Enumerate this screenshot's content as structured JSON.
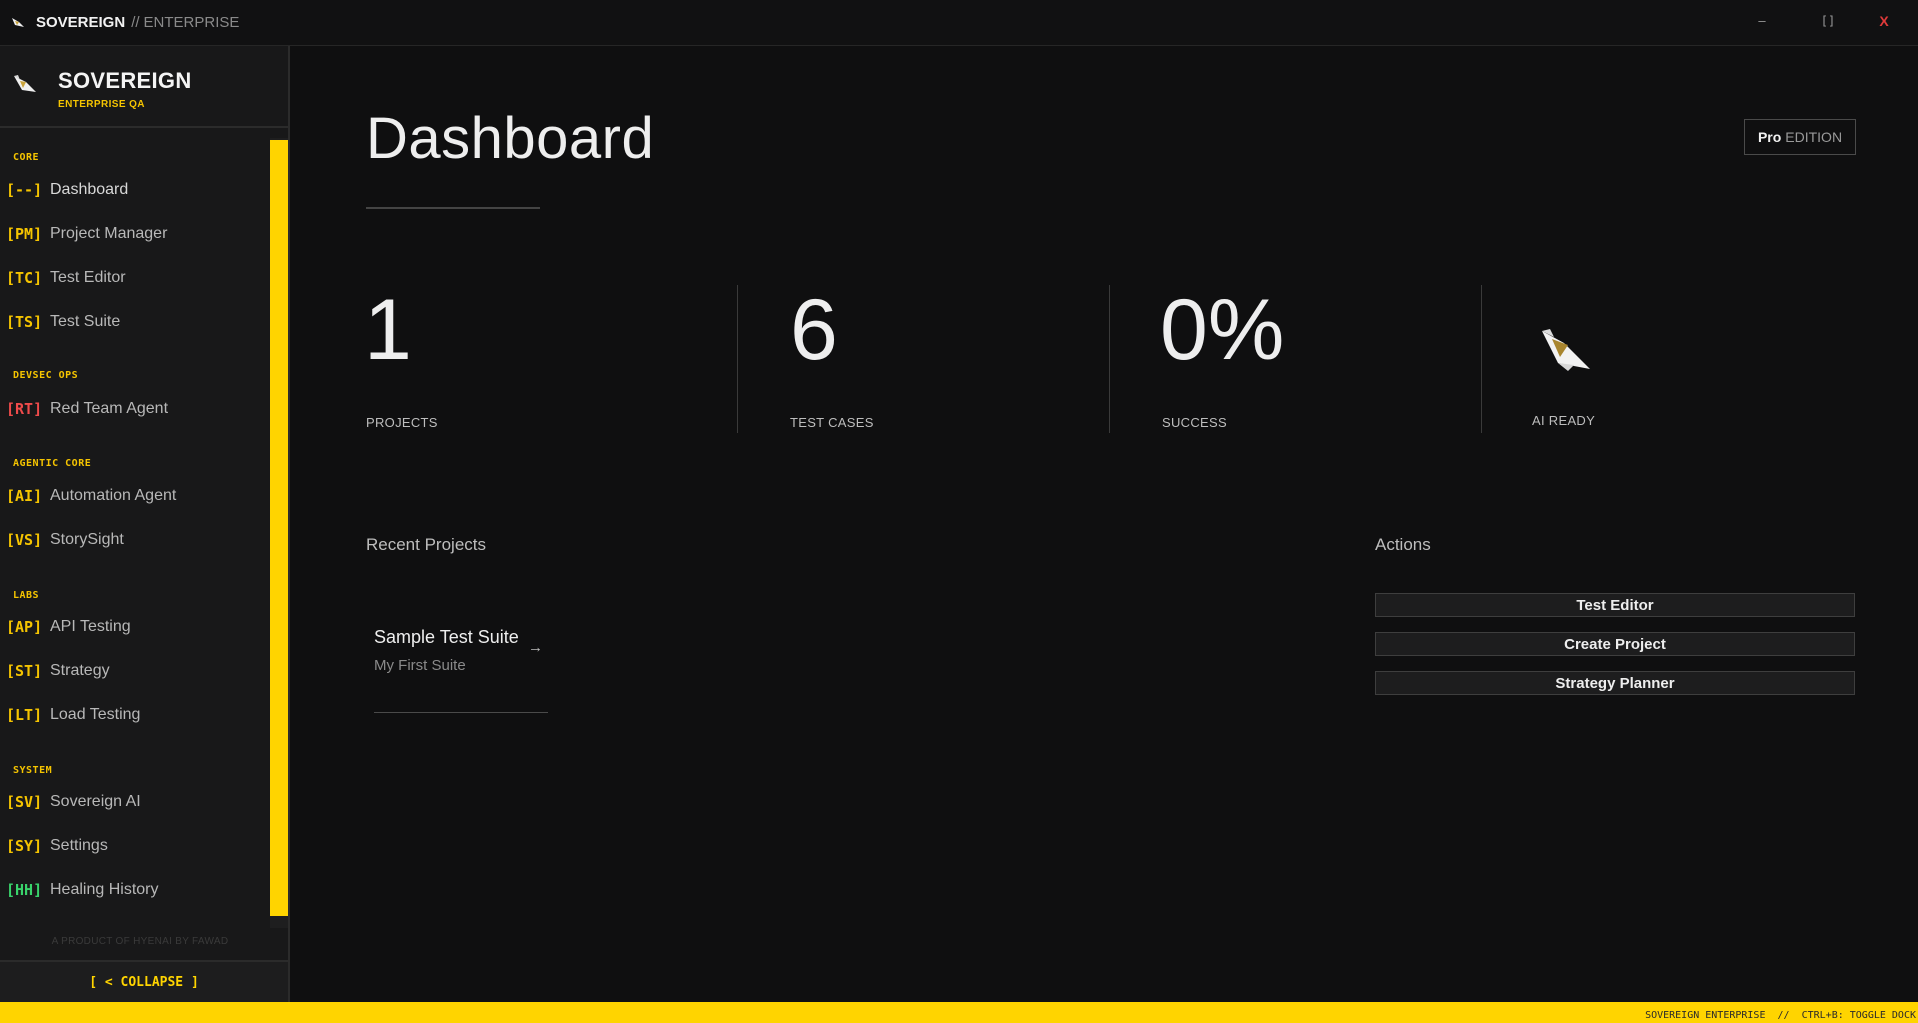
{
  "titlebar": {
    "app_name": "SOVEREIGN",
    "separator": "//",
    "edition": "ENTERPRISE",
    "minimize": "–",
    "maximize": "[]",
    "close": "X"
  },
  "sidebar": {
    "brand_name": "SOVEREIGN",
    "brand_sub": "ENTERPRISE QA",
    "sections": {
      "core": "CORE",
      "devsec": "DEVSEC OPS",
      "agentic": "AGENTIC CORE",
      "labs": "LABS",
      "system": "SYSTEM"
    },
    "items": [
      {
        "code": "[--]",
        "label": "Dashboard",
        "color": "yellow"
      },
      {
        "code": "[PM]",
        "label": "Project Manager",
        "color": "yellow"
      },
      {
        "code": "[TC]",
        "label": "Test Editor",
        "color": "yellow"
      },
      {
        "code": "[TS]",
        "label": "Test Suite",
        "color": "yellow"
      },
      {
        "code": "[RT]",
        "label": "Red Team Agent",
        "color": "red"
      },
      {
        "code": "[AI]",
        "label": "Automation Agent",
        "color": "yellow"
      },
      {
        "code": "[VS]",
        "label": "StorySight",
        "color": "yellow"
      },
      {
        "code": "[AP]",
        "label": "API Testing",
        "color": "yellow"
      },
      {
        "code": "[ST]",
        "label": "Strategy",
        "color": "yellow"
      },
      {
        "code": "[LT]",
        "label": "Load Testing",
        "color": "yellow"
      },
      {
        "code": "[SV]",
        "label": "Sovereign AI",
        "color": "yellow"
      },
      {
        "code": "[SY]",
        "label": "Settings",
        "color": "yellow"
      },
      {
        "code": "[HH]",
        "label": "Healing History",
        "color": "green"
      }
    ],
    "product": "A PRODUCT OF HYENAI BY FAWAD",
    "collapse": "[ < COLLAPSE ]"
  },
  "main": {
    "title": "Dashboard",
    "badge_pro": "Pro",
    "badge_edition": "EDITION",
    "stats": [
      {
        "value": "1",
        "caption": "PROJECTS"
      },
      {
        "value": "6",
        "caption": "TEST CASES"
      },
      {
        "value": "0%",
        "caption": "SUCCESS"
      }
    ],
    "ai_caption": "AI READY",
    "recent_title": "Recent Projects",
    "actions_title": "Actions",
    "projects": [
      {
        "name": "Sample Test Suite",
        "subtitle": "My First Suite",
        "arrow": "→"
      }
    ],
    "actions": [
      "Test Editor",
      "Create Project",
      "Strategy Planner"
    ]
  },
  "statusbar": {
    "text": "SOVEREIGN ENTERPRISE  //  CTRL+B: TOGGLE DOCK"
  },
  "colors": {
    "accent": "#ffd400",
    "red_code": "#ef4b4b",
    "green_code": "#39d36b",
    "close": "#e03a3a"
  }
}
